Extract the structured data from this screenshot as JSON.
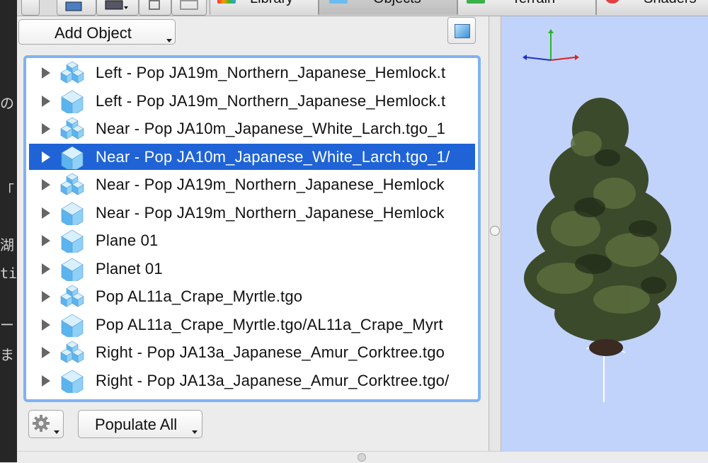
{
  "toolbar": {
    "tabs": [
      {
        "label": "Library",
        "active": false
      },
      {
        "label": "Objects",
        "active": true
      },
      {
        "label": "Terrain",
        "active": false
      },
      {
        "label": "Shaders",
        "active": false
      }
    ]
  },
  "objects_panel": {
    "add_object_label": "Add Object",
    "populate_all_label": "Populate All",
    "items": [
      {
        "label": "Left - Pop JA19m_Northern_Japanese_Hemlock.t",
        "icon": "grouped-cubes-icon"
      },
      {
        "label": "Left - Pop JA19m_Northern_Japanese_Hemlock.t",
        "icon": "single-cube-icon"
      },
      {
        "label": "Near - Pop JA10m_Japanese_White_Larch.tgo_1",
        "icon": "grouped-cubes-icon"
      },
      {
        "label": "Near - Pop JA10m_Japanese_White_Larch.tgo_1/",
        "icon": "single-cube-icon",
        "selected": true
      },
      {
        "label": "Near - Pop JA19m_Northern_Japanese_Hemlock",
        "icon": "grouped-cubes-icon"
      },
      {
        "label": "Near - Pop JA19m_Northern_Japanese_Hemlock",
        "icon": "single-cube-icon"
      },
      {
        "label": "Plane 01",
        "icon": "single-cube-icon"
      },
      {
        "label": "Planet 01",
        "icon": "single-cube-icon"
      },
      {
        "label": "Pop AL11a_Crape_Myrtle.tgo",
        "icon": "grouped-cubes-icon"
      },
      {
        "label": "Pop AL11a_Crape_Myrtle.tgo/AL11a_Crape_Myrt",
        "icon": "single-cube-icon"
      },
      {
        "label": "Right - Pop JA13a_Japanese_Amur_Corktree.tgo",
        "icon": "grouped-cubes-icon"
      },
      {
        "label": "Right - Pop JA13a_Japanese_Amur_Corktree.tgo/",
        "icon": "single-cube-icon"
      }
    ]
  },
  "editor_strip": {
    "fragments": [
      "の",
      "「",
      "湖",
      "ti",
      "ー",
      "ま"
    ]
  },
  "colors": {
    "selection": "#1f63d6",
    "focus_ring": "#7fb3f0",
    "viewport_bg": "#c2d3fb",
    "cube_blue": "#5bb4ee"
  }
}
